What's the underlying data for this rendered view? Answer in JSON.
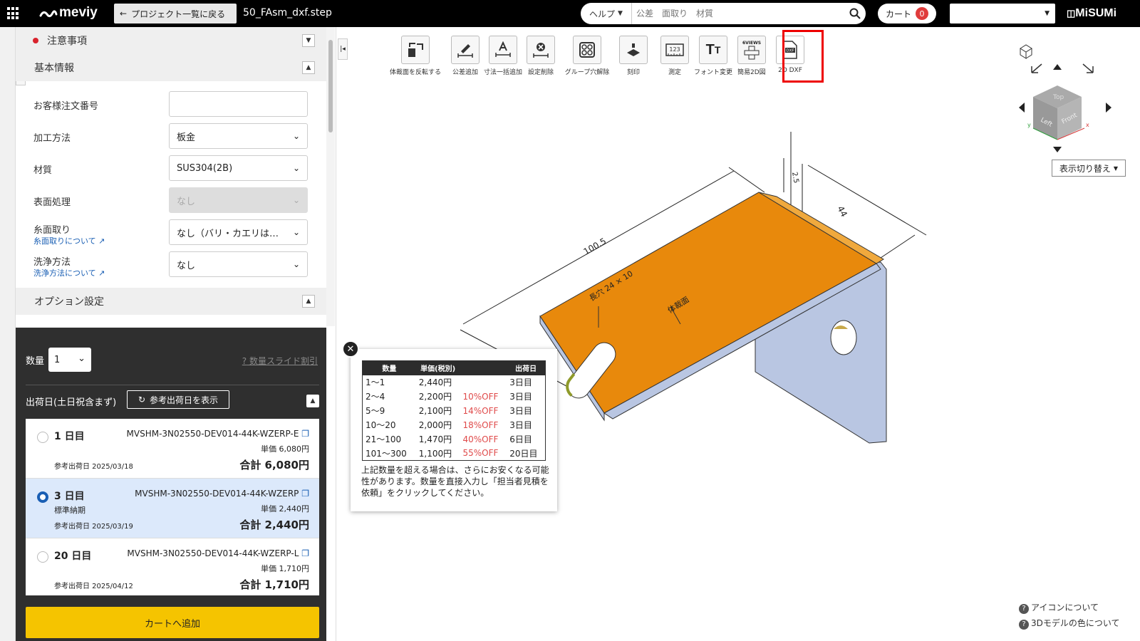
{
  "topbar": {
    "logo": "meviy",
    "back_label": "プロジェクト一覧に戻る",
    "filename": "50_FAsm_dxf.step",
    "help_label": "ヘルプ",
    "search_placeholder": "公差　面取り　材質",
    "cart_label": "カート",
    "cart_count": "0",
    "brand": "MiSUMi"
  },
  "left": {
    "notice_title": "注意事項",
    "basic_title": "基本情報",
    "fields": [
      {
        "label": "お客様注文番号",
        "value": ""
      },
      {
        "label": "加工方法",
        "value": "板金"
      },
      {
        "label": "材質",
        "value": "SUS304(2B)"
      },
      {
        "label": "表面処理",
        "value": "なし"
      },
      {
        "label": "糸面取り",
        "link": "糸面取りについて",
        "value": "なし（バリ・カエリは…"
      },
      {
        "label": "洗浄方法",
        "link": "洗浄方法について",
        "value": "なし"
      }
    ],
    "option_title": "オプション設定"
  },
  "order": {
    "qty_label": "数量",
    "qty_value": "1",
    "qty_slide": "数量スライド割引",
    "ship_label": "出荷日(土日祝含まず)",
    "ref_button": "参考出荷日を表示",
    "options": [
      {
        "days": "1 日目",
        "sub": "",
        "part": "MVSHM-3N02550-DEV014-44K-WZERP-E",
        "unit": "単価 6,080円",
        "date": "参考出荷日  2025/03/18",
        "total": "合計 6,080円"
      },
      {
        "days": "3 日目",
        "sub": "標準納期",
        "part": "MVSHM-3N02550-DEV014-44K-WZERP",
        "unit": "単価 2,440円",
        "date": "参考出荷日  2025/03/19",
        "total": "合計 2,440円"
      },
      {
        "days": "20 日目",
        "sub": "",
        "part": "MVSHM-3N02550-DEV014-44K-WZERP-L",
        "unit": "単価 1,710円",
        "date": "参考出荷日  2025/04/12",
        "total": "合計 1,710円"
      }
    ],
    "cart_add": "カートへ追加"
  },
  "toolbar": {
    "tools": [
      {
        "label": "体裁面を反転する",
        "icon": "flip-face-icon"
      },
      {
        "label": "公差追加",
        "icon": "tolerance-add-icon"
      },
      {
        "label": "寸法一括追加",
        "icon": "dimension-bulk-add-icon"
      },
      {
        "label": "設定削除",
        "icon": "settings-delete-icon"
      },
      {
        "label": "グループ穴解除",
        "icon": "group-hole-release-icon"
      },
      {
        "label": "刻印",
        "icon": "stamp-icon"
      },
      {
        "label": "測定",
        "icon": "measure-icon"
      },
      {
        "label": "フォント変更",
        "icon": "font-change-icon"
      },
      {
        "label": "簡易2D図",
        "icon": "simple-2d-drawing-icon",
        "badge": "6VIEWS"
      },
      {
        "label": "2D DXF",
        "icon": "dxf-export-icon",
        "badge": "DXF"
      }
    ]
  },
  "model": {
    "dim_length": "100.5",
    "dim_width": "44",
    "dim_thickness": "2.5",
    "slot_label": "長穴 24 × 10",
    "face_label": "体裁面",
    "colors": {
      "top_face": "#e8890c",
      "side_face": "#b9c6e2",
      "edge": "#333333"
    }
  },
  "navcube": {
    "faces": [
      "Top",
      "Front",
      "Left"
    ],
    "axes": [
      "x",
      "y"
    ],
    "view_switch": "表示切り替え"
  },
  "help": {
    "icons": "アイコンについて",
    "colors": "3Dモデルの色について"
  },
  "popup": {
    "headers": [
      "数量",
      "単価(税別)",
      "",
      "出荷日"
    ],
    "rows": [
      [
        "1〜1",
        "2,440円",
        "",
        "3日目"
      ],
      [
        "2〜4",
        "2,200円",
        "10%OFF",
        "3日目"
      ],
      [
        "5〜9",
        "2,100円",
        "14%OFF",
        "3日目"
      ],
      [
        "10〜20",
        "2,000円",
        "18%OFF",
        "3日目"
      ],
      [
        "21〜100",
        "1,470円",
        "40%OFF",
        "6日目"
      ],
      [
        "101〜300",
        "1,100円",
        "55%OFF",
        "20日目"
      ]
    ],
    "note": "上記数量を超える場合は、さらにお安くなる可能性があります。数量を直接入力し「担当者見積を依頼」をクリックしてください。"
  }
}
